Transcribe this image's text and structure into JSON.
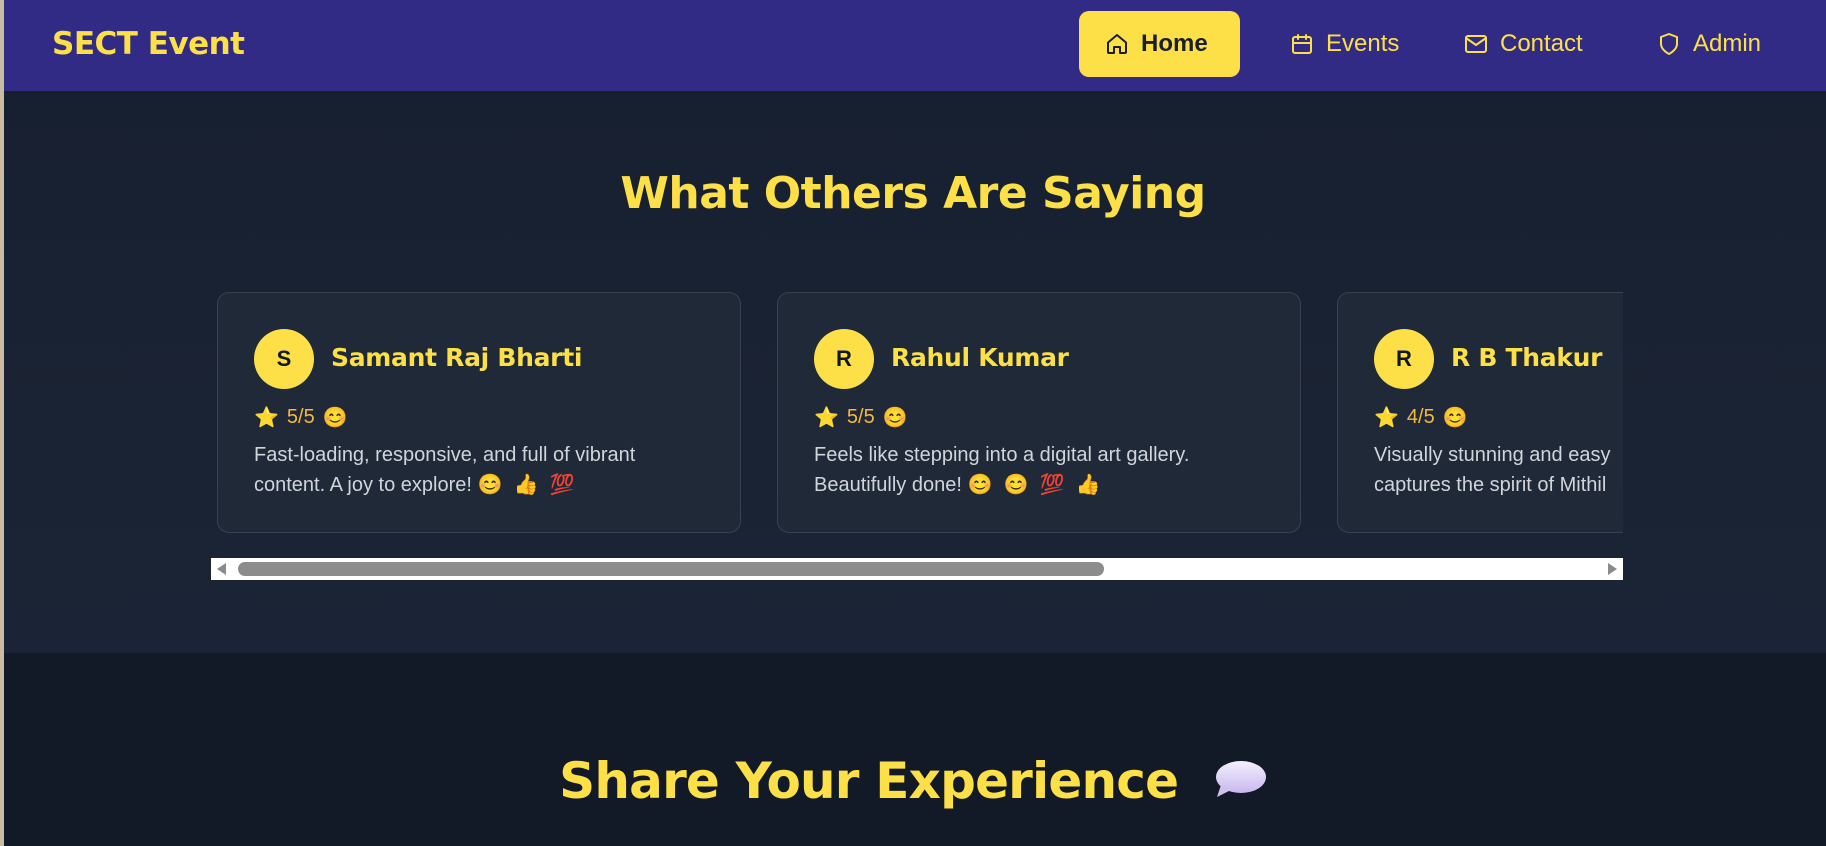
{
  "nav": {
    "brand": "SECT Event",
    "items": [
      {
        "label": "Home",
        "icon": "home-icon",
        "active": true
      },
      {
        "label": "Events",
        "icon": "calendar-icon",
        "active": false
      },
      {
        "label": "Contact",
        "icon": "mail-icon",
        "active": false
      },
      {
        "label": "Admin",
        "icon": "shield-icon",
        "active": false
      }
    ]
  },
  "testimonials": {
    "title": "What Others Are Saying",
    "cards": [
      {
        "initial": "S",
        "name": "Samant Raj Bharti",
        "rating": "5/5",
        "line1": "Fast-loading, responsive, and full of vibrant",
        "line2": "content. A joy to explore!"
      },
      {
        "initial": "R",
        "name": "Rahul Kumar",
        "rating": "5/5",
        "line1": "Feels like stepping into a digital art gallery.",
        "line2": "Beautifully done!"
      },
      {
        "initial": "R",
        "name": "R B Thakur",
        "rating": "4/5",
        "line1": "Visually stunning and easy",
        "line2": "captures the spirit of Mithil"
      }
    ]
  },
  "share": {
    "title": "Share Your Experience"
  },
  "colors": {
    "accent": "#fde047",
    "navbar": "#322b86",
    "background": "#141b29",
    "card": "#1f2937"
  }
}
